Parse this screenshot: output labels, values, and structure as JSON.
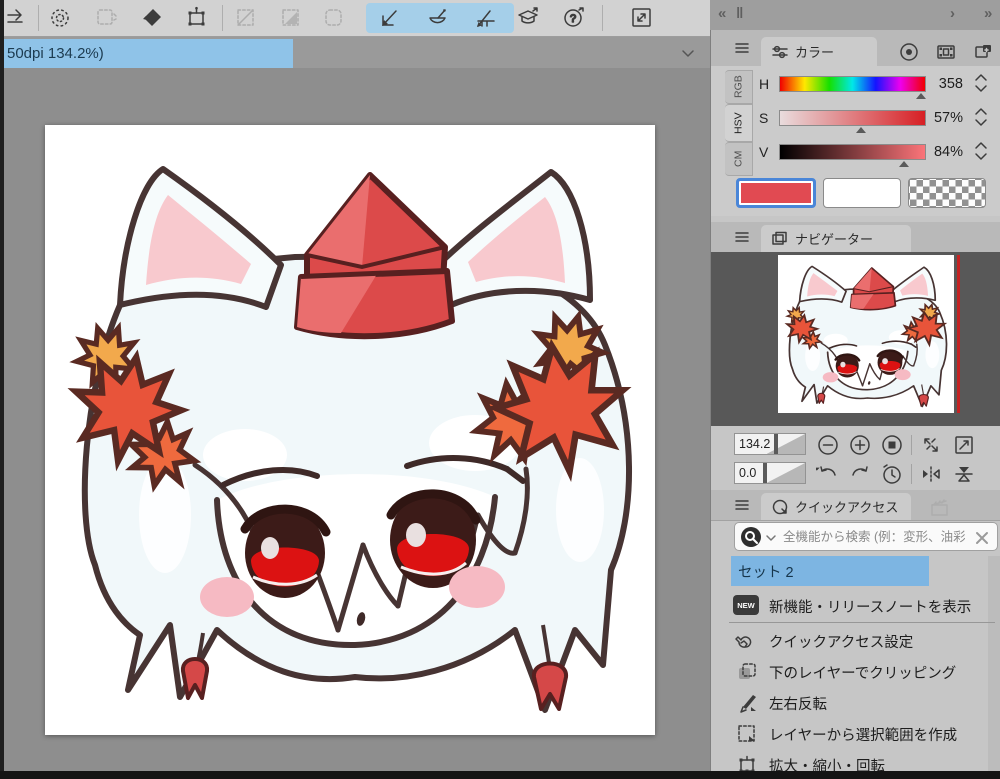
{
  "tab_bar": {
    "canvas_tab_label": "50dpi 134.2%)"
  },
  "top_right": {
    "collapse_glyph": "«",
    "handle_glyph": "‖",
    "next_glyph": "›",
    "expand_glyph": "»"
  },
  "color_panel": {
    "tab_label": "カラー",
    "rail": {
      "rgb": "RGB",
      "hsv": "HSV",
      "cm": "CM"
    },
    "sliders": [
      {
        "label": "H",
        "value": "358"
      },
      {
        "label": "S",
        "value": "57%"
      },
      {
        "label": "V",
        "value": "84%"
      }
    ],
    "swatches": {
      "main_color": "#e14a52",
      "sub_color": "#ffffff",
      "transparent": "checker"
    }
  },
  "navigator": {
    "tab_label": "ナビゲーター",
    "zoom_value": "134.2",
    "rotation_value": "0.0"
  },
  "quick_access": {
    "tab_label": "クイックアクセス",
    "search_placeholder": "全機能から検索 (例：変形、油彩ブラシ)",
    "set_label": "セット 2",
    "menu": [
      {
        "badge": "NEW",
        "label": "新機能・リリースノートを表示"
      },
      {
        "label": "クイックアクセス設定"
      },
      {
        "label": "下のレイヤーでクリッピング"
      },
      {
        "label": "左右反転"
      },
      {
        "label": "レイヤーから選択範囲を作成"
      },
      {
        "label": "拡大・縮小・回転"
      }
    ]
  }
}
